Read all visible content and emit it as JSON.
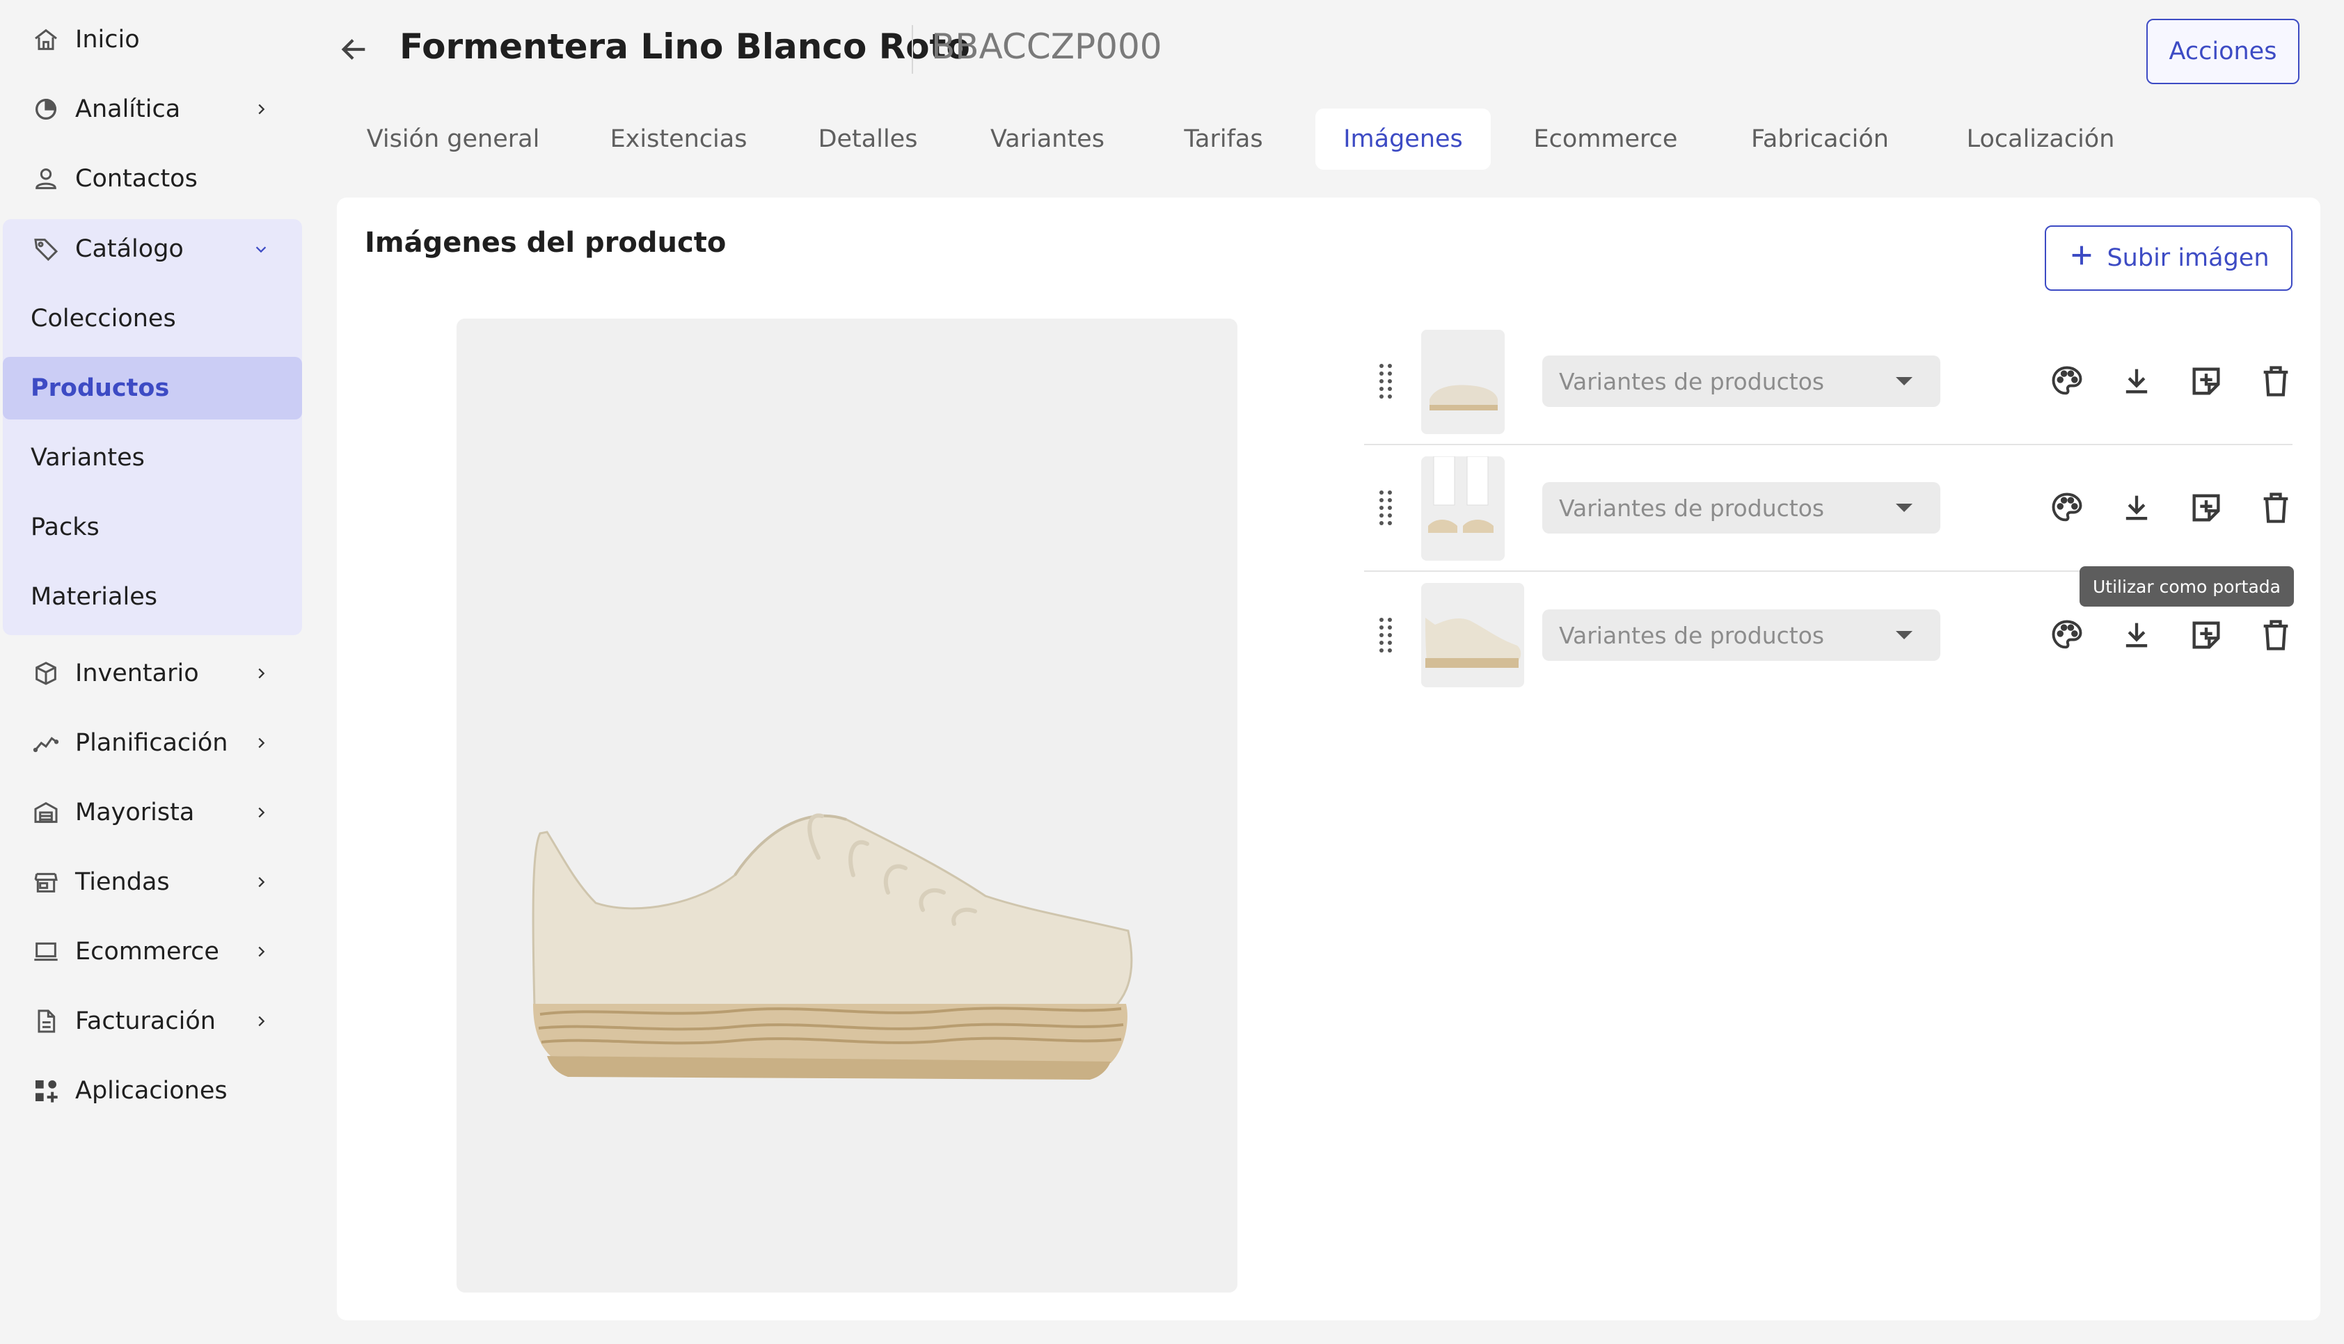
{
  "sidebar": {
    "items": [
      {
        "label": "Inicio",
        "icon": "home-icon"
      },
      {
        "label": "Analítica",
        "icon": "analytics-icon"
      },
      {
        "label": "Contactos",
        "icon": "person-icon"
      },
      {
        "label": "Catálogo",
        "icon": "tag-icon"
      },
      {
        "label": "Inventario",
        "icon": "box-icon"
      },
      {
        "label": "Planificación",
        "icon": "trend-icon"
      },
      {
        "label": "Mayorista",
        "icon": "warehouse-icon"
      },
      {
        "label": "Tiendas",
        "icon": "store-icon"
      },
      {
        "label": "Ecommerce",
        "icon": "laptop-icon"
      },
      {
        "label": "Facturación",
        "icon": "invoice-icon"
      },
      {
        "label": "Aplicaciones",
        "icon": "apps-icon"
      }
    ],
    "catalog_sub": [
      {
        "label": "Colecciones"
      },
      {
        "label": "Productos",
        "active": true
      },
      {
        "label": "Variantes"
      },
      {
        "label": "Packs"
      },
      {
        "label": "Materiales"
      }
    ]
  },
  "header": {
    "title": "Formentera Lino Blanco Roto",
    "code": "BBACCZP000",
    "actions_label": "Acciones"
  },
  "tabs": [
    {
      "label": "Visión general"
    },
    {
      "label": "Existencias"
    },
    {
      "label": "Detalles"
    },
    {
      "label": "Variantes"
    },
    {
      "label": "Tarifas"
    },
    {
      "label": "Imágenes",
      "active": true
    },
    {
      "label": "Ecommerce"
    },
    {
      "label": "Fabricación"
    },
    {
      "label": "Localización"
    }
  ],
  "images_section": {
    "title": "Imágenes del producto",
    "upload_label": "Subir imágen",
    "rows": [
      {
        "placeholder": "Variantes de productos",
        "thumbnail": "espadrille-angle"
      },
      {
        "placeholder": "Variantes de productos",
        "thumbnail": "espadrille-worn"
      },
      {
        "placeholder": "Variantes de productos",
        "thumbnail": "espadrille-side"
      }
    ],
    "tooltip": "Utilizar como portada"
  },
  "colors": {
    "accent": "#3d4bc4",
    "catalog_bg": "#e8e8fa",
    "active_bg": "#cbcdf5"
  }
}
